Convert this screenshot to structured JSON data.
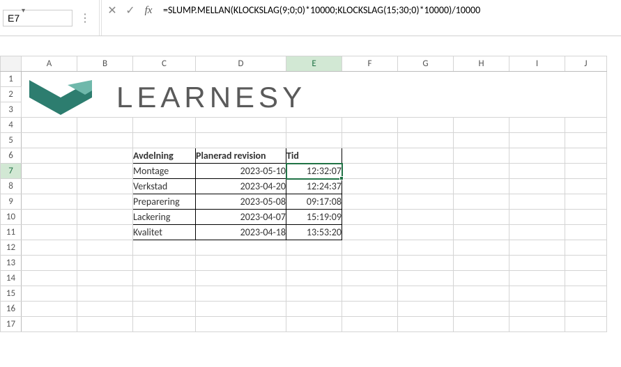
{
  "formulaBar": {
    "nameBox": "E7",
    "formula": "=SLUMP.MELLAN(KLOCKSLAG(9;0;0)*10000;KLOCKSLAG(15;30;0)*10000)/10000"
  },
  "columns": [
    "A",
    "B",
    "C",
    "D",
    "E",
    "F",
    "G",
    "H",
    "I",
    "J"
  ],
  "rows": [
    "1",
    "2",
    "3",
    "4",
    "5",
    "6",
    "7",
    "8",
    "9",
    "10",
    "11",
    "12",
    "13",
    "14",
    "15",
    "16",
    "17"
  ],
  "logoText": "LEARNESY",
  "table": {
    "headers": {
      "c": "Avdelning",
      "d": "Planerad revision",
      "e": "Tid"
    },
    "rows": [
      {
        "c": "Montage",
        "d": "2023-05-10",
        "e": "12:32:07"
      },
      {
        "c": "Verkstad",
        "d": "2023-04-20",
        "e": "12:24:37"
      },
      {
        "c": "Preparering",
        "d": "2023-05-08",
        "e": "09:17:08"
      },
      {
        "c": "Lackering",
        "d": "2023-04-07",
        "e": "15:19:09"
      },
      {
        "c": "Kvalitet",
        "d": "2023-04-18",
        "e": "13:53:20"
      }
    ]
  },
  "activeCell": "E7"
}
